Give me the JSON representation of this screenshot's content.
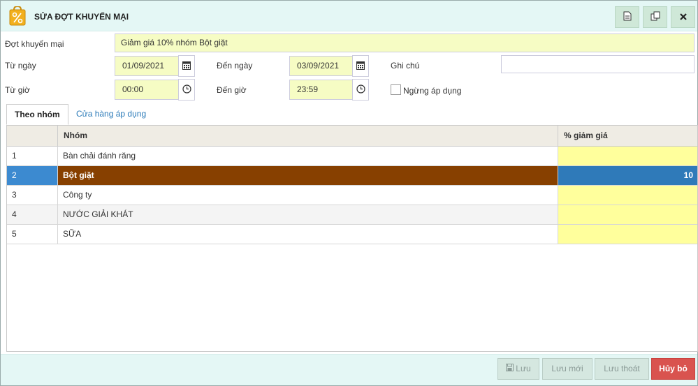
{
  "dialog": {
    "title": "SỬA ĐỢT KHUYẾN MẠI",
    "icons": [
      "promo-bag-icon",
      "document-icon",
      "copy-icon",
      "close-icon"
    ]
  },
  "form": {
    "campaign_label": "Đợt khuyến mại",
    "campaign_value": "Giảm giá 10% nhóm Bột giặt",
    "from_date_label": "Từ ngày",
    "from_date_value": "01/09/2021",
    "to_date_label": "Đến ngày",
    "to_date_value": "03/09/2021",
    "note_label": "Ghi chú",
    "note_value": "",
    "from_time_label": "Từ giờ",
    "from_time_value": "00:00",
    "to_time_label": "Đến giờ",
    "to_time_value": "23:59",
    "stop_label": "Ngừng áp dụng",
    "stop_checked": false
  },
  "tabs": [
    {
      "label": "Theo nhóm",
      "active": true
    },
    {
      "label": "Cửa hàng áp dụng",
      "active": false
    }
  ],
  "grid": {
    "headers": [
      "",
      "Nhóm",
      "% giảm giá"
    ],
    "rows": [
      {
        "no": "1",
        "name": "Bàn chải đánh răng",
        "discount": ""
      },
      {
        "no": "2",
        "name": "Bột giặt",
        "discount": "10",
        "selected": true
      },
      {
        "no": "3",
        "name": "Công ty",
        "discount": ""
      },
      {
        "no": "4",
        "name": "NƯỚC GIẢI KHÁT",
        "discount": ""
      },
      {
        "no": "5",
        "name": "SỮA",
        "discount": ""
      }
    ]
  },
  "footer": {
    "save_label": "Lưu",
    "save_new_label": "Lưu mới",
    "save_exit_label": "Lưu thoát",
    "cancel_label": "Hủy bỏ"
  },
  "colors": {
    "header_bg": "#e4f7f5",
    "field_bg": "#f6fcc4",
    "selected_row": "#874000",
    "selected_accent": "#3c8ad0",
    "cancel": "#d9534f",
    "tab_link": "#2a7ab8"
  }
}
